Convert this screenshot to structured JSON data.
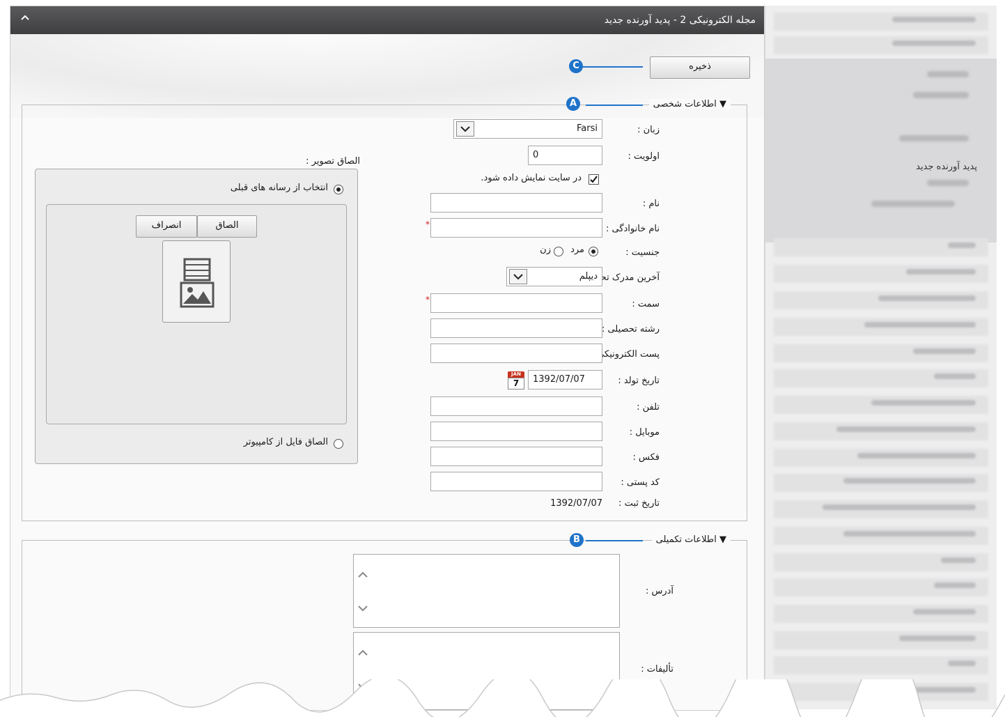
{
  "window": {
    "title": "مجله الکترونیکی 2 - پدید آورنده جدید",
    "collapse_icon": "chevron-up-icon"
  },
  "sidebar": {
    "active_item": "پدید آورنده جدید"
  },
  "toolbar": {
    "save_label": "ذخیره"
  },
  "markers": {
    "a": "A",
    "b": "B",
    "c": "C"
  },
  "personal": {
    "legend": "اطلاعات شخصی",
    "language_label": "زبان :",
    "language_value": "Farsi",
    "priority_label": "اولویت :",
    "priority_value": "0",
    "show_on_site_label": "در سایت نمایش داده شود.",
    "first_name_label": "نام :",
    "last_name_label": "نام خانوادگی :",
    "gender_label": "جنسیت :",
    "gender_male": "مرد",
    "gender_female": "زن",
    "degree_label": "آخرین مدرک تحصیلی :",
    "degree_value": "دیپلم",
    "position_label": "سمت :",
    "field_of_study_label": "رشته تحصیلی :",
    "email_label": "پست الکترونیکی :",
    "birth_date_label": "تاریخ تولد :",
    "birth_date_value": "1392/07/07",
    "calendar_month": "JAN",
    "calendar_day": "7",
    "phone_label": "تلفن :",
    "mobile_label": "موبایل :",
    "fax_label": "فکس :",
    "postal_code_label": "کد پستی :",
    "registration_date_label": "تاریخ ثبت :",
    "registration_date_value": "1392/07/07",
    "required_mark": "*"
  },
  "image": {
    "label": "الصاق تصویر :",
    "option_previous_media": "انتخاب از رسانه های قبلی",
    "attach_button": "الصاق",
    "cancel_button": "انصراف",
    "option_upload": "الصاق فایل از کامپیوتر"
  },
  "additional": {
    "legend": "اطلاعات تکمیلی",
    "address_label": "آدرس :",
    "works_label": "تألیفات :"
  },
  "colors": {
    "marker_blue": "#1f73c9",
    "titlebar": "#4a4a4c",
    "required_red": "#d02020"
  }
}
